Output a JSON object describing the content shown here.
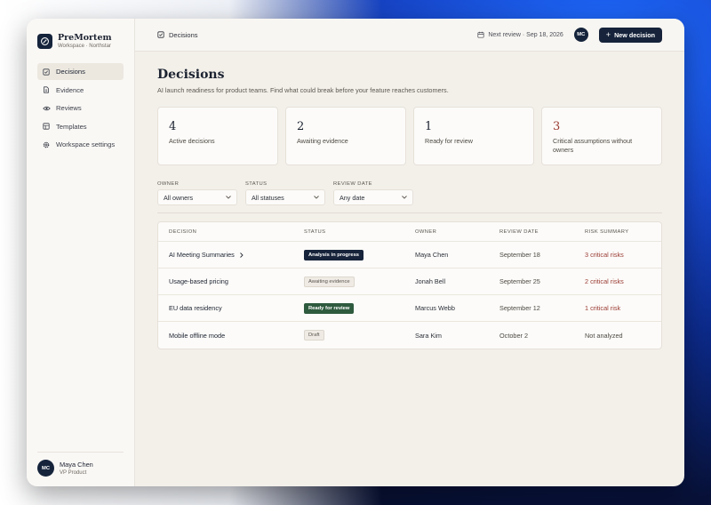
{
  "brand": {
    "name": "PreMortem",
    "workspace": "Workspace · Northstar"
  },
  "sidebar": {
    "items": [
      {
        "label": "Decisions",
        "icon": "checkbox-icon",
        "active": true
      },
      {
        "label": "Evidence",
        "icon": "document-icon"
      },
      {
        "label": "Reviews",
        "icon": "eye-icon"
      },
      {
        "label": "Templates",
        "icon": "template-icon"
      },
      {
        "label": "Workspace settings",
        "icon": "gear-icon"
      }
    ],
    "user": {
      "initials": "MC",
      "name": "Maya Chen",
      "role": "VP Product"
    }
  },
  "topbar": {
    "breadcrumb": "Decisions",
    "next_review": "Next review · Sep 18, 2026",
    "avatar_initials": "MC",
    "new_button": "New decision"
  },
  "page": {
    "title": "Decisions",
    "subtitle": "AI launch readiness for product teams. Find what could break before your feature reaches customers."
  },
  "stats": [
    {
      "value": "4",
      "label": "Active decisions"
    },
    {
      "value": "2",
      "label": "Awaiting evidence"
    },
    {
      "value": "1",
      "label": "Ready for review"
    },
    {
      "value": "3",
      "label": "Critical assumptions without owners"
    }
  ],
  "filters": {
    "owner": {
      "label": "OWNER",
      "value": "All owners"
    },
    "status": {
      "label": "STATUS",
      "value": "All statuses"
    },
    "review_date": {
      "label": "REVIEW DATE",
      "value": "Any date"
    }
  },
  "table": {
    "columns": [
      "DECISION",
      "STATUS",
      "OWNER",
      "REVIEW DATE",
      "RISK SUMMARY"
    ],
    "rows": [
      {
        "decision": "AI Meeting Summaries",
        "status": "Analysis in progress",
        "owner": "Maya Chen",
        "review_date": "September 18",
        "risk": "3 critical risks"
      },
      {
        "decision": "Usage-based pricing",
        "status": "Awaiting evidence",
        "owner": "Jonah Bell",
        "review_date": "September 25",
        "risk": "2 critical risks"
      },
      {
        "decision": "EU data residency",
        "status": "Ready for review",
        "owner": "Marcus Webb",
        "review_date": "September 12",
        "risk": "1 critical risk"
      },
      {
        "decision": "Mobile offline mode",
        "status": "Draft",
        "owner": "Sara Kim",
        "review_date": "October 2",
        "risk": "Not analyzed"
      }
    ]
  },
  "colors": {
    "primary": "#16233a",
    "critical": "#9a3a32",
    "ready": "#2e5a3e",
    "background": "#f3f0ea"
  }
}
